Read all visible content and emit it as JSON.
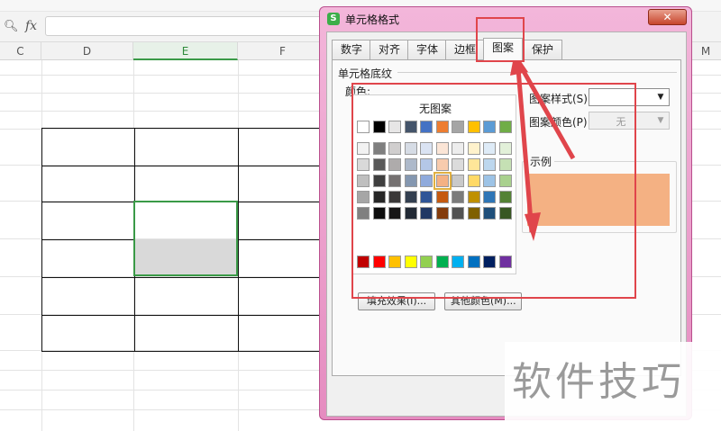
{
  "formula_bar": {
    "fx_label": "fx"
  },
  "columns": [
    {
      "label": "C",
      "selected": false
    },
    {
      "label": "D",
      "selected": false
    },
    {
      "label": "E",
      "selected": true
    },
    {
      "label": "F",
      "selected": false
    },
    {
      "label": "M",
      "selected": false
    }
  ],
  "dialog": {
    "title": "单元格格式",
    "tabs": [
      "数字",
      "对齐",
      "字体",
      "边框",
      "图案",
      "保护"
    ],
    "active_tab": "图案",
    "section_title": "单元格底纹",
    "color_label": "颜色:",
    "no_pattern": "无图案",
    "fill_effects_button": "填充效果(I)...",
    "more_colors_button": "其他颜色(M)...",
    "pattern_style_label": "图案样式(S):",
    "pattern_style_value": "",
    "pattern_color_label": "图案颜色(P):",
    "pattern_color_value": "无",
    "example_label": "示例",
    "example_color": "#f4b183",
    "palette": {
      "top_row": [
        "#ffffff",
        "#000000",
        "#e7e6e6",
        "#44546a",
        "#4472c4",
        "#ed7d31",
        "#a5a5a5",
        "#ffc000",
        "#5b9bd5",
        "#70ad47"
      ],
      "shade_rows": [
        [
          "#f2f2f2",
          "#7f7f7f",
          "#d0cece",
          "#d6dce5",
          "#dae3f3",
          "#fbe5d6",
          "#ededed",
          "#fff2cc",
          "#deebf7",
          "#e2f0d9"
        ],
        [
          "#d9d9d9",
          "#595959",
          "#aeabab",
          "#adb9ca",
          "#b4c7e7",
          "#f8cbad",
          "#dbdbdb",
          "#ffe699",
          "#bdd7ee",
          "#c5e0b4"
        ],
        [
          "#bfbfbf",
          "#3f3f3f",
          "#757171",
          "#8497b0",
          "#8faadc",
          "#f4b183",
          "#c9c9c9",
          "#ffd966",
          "#9dc3e6",
          "#a9d18e"
        ],
        [
          "#a6a6a6",
          "#262626",
          "#3a3838",
          "#333f50",
          "#2f5597",
          "#c55a11",
          "#7b7b7b",
          "#bf9000",
          "#2e75b6",
          "#548235"
        ],
        [
          "#808080",
          "#0d0d0d",
          "#171616",
          "#222a35",
          "#203864",
          "#843c0c",
          "#525252",
          "#7f6000",
          "#1f4e79",
          "#385723"
        ]
      ],
      "standard_row": [
        "#c00000",
        "#ff0000",
        "#ffc000",
        "#ffff00",
        "#92d050",
        "#00b050",
        "#00b0f0",
        "#0070c0",
        "#002060",
        "#7030a0"
      ],
      "selected_color": "#f4b183"
    }
  },
  "annotation_color": "#e0454b",
  "watermark": "软件技巧"
}
